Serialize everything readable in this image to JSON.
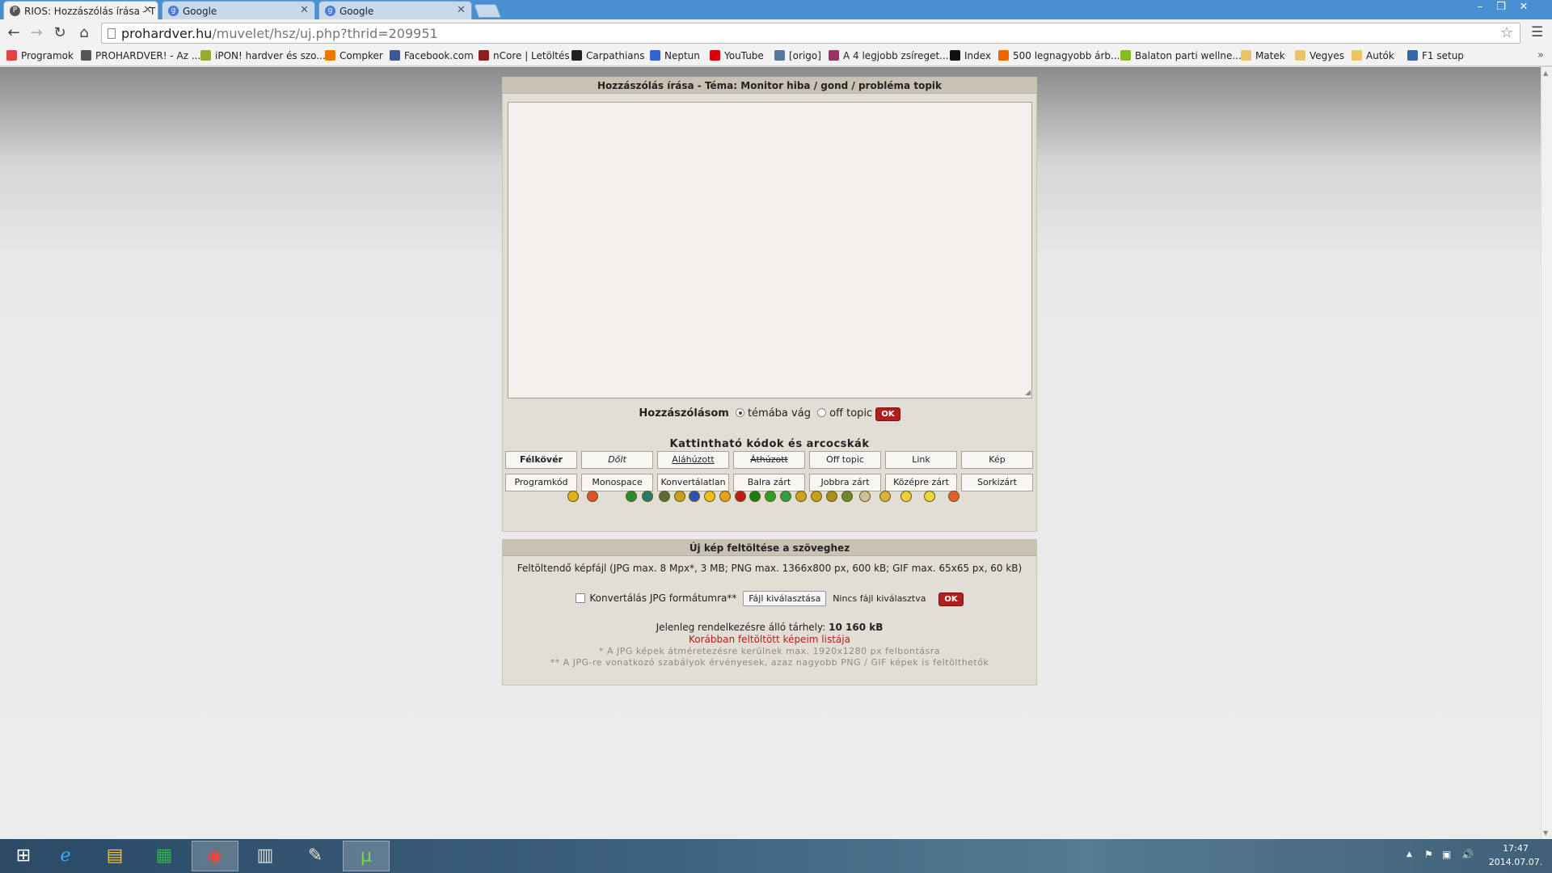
{
  "tabs": [
    {
      "title": "RIOS: Hozzászólás írása - T",
      "icon": "prohardver-icon",
      "active": true
    },
    {
      "title": "Google",
      "icon": "google-icon",
      "active": false
    },
    {
      "title": "Google",
      "icon": "google-icon",
      "active": false
    }
  ],
  "url": {
    "domain": "prohardver.hu",
    "path": "/muvelet/hsz/uj.php?thrid=209951"
  },
  "bookmarks": [
    {
      "label": "Programok",
      "icon": "apps-grid-icon",
      "color": "#d44"
    },
    {
      "label": "PROHARDVER! - Az ...",
      "icon": "prohardver-icon",
      "color": "#555"
    },
    {
      "label": "iPON! hardver és szo...",
      "icon": "ipon-icon",
      "color": "#9a3"
    },
    {
      "label": "Compker",
      "icon": "compker-icon",
      "color": "#e70"
    },
    {
      "label": "Facebook.com",
      "icon": "facebook-icon",
      "color": "#3b5998"
    },
    {
      "label": "nCore | Letöltés",
      "icon": "ncore-icon",
      "color": "#822"
    },
    {
      "label": "Carpathians",
      "icon": "carpathians-icon",
      "color": "#222"
    },
    {
      "label": "Neptun",
      "icon": "neptun-icon",
      "color": "#36c"
    },
    {
      "label": "YouTube",
      "icon": "youtube-icon",
      "color": "#d00"
    },
    {
      "label": "[origo]",
      "icon": "origo-icon",
      "color": "#579"
    },
    {
      "label": "A 4 legjobb zsíreget...",
      "icon": "bookmark-icon",
      "color": "#936"
    },
    {
      "label": "Index",
      "icon": "index-icon",
      "color": "#111"
    },
    {
      "label": "500 legnagyobb árb...",
      "icon": "bookmark-icon",
      "color": "#e60"
    },
    {
      "label": "Balaton parti wellne...",
      "icon": "bookmark-icon",
      "color": "#8b2"
    },
    {
      "label": "Matek",
      "icon": "folder-icon",
      "color": "#e9c46a"
    },
    {
      "label": "Vegyes",
      "icon": "folder-icon",
      "color": "#e9c46a"
    },
    {
      "label": "Autók",
      "icon": "folder-icon",
      "color": "#e9c46a"
    },
    {
      "label": "F1 setup",
      "icon": "bookmark-icon",
      "color": "#36a"
    }
  ],
  "post": {
    "header": "Hozzászólás írása - Téma: Monitor hiba / gond / probléma topik",
    "type_label": "Hozzászólásom",
    "opt_on_topic": "témába vág",
    "opt_off_topic": "off topic",
    "ok": "OK",
    "codes_title": "Kattintható kódok és arcocskák",
    "buttons_row1": [
      "Félkövér",
      "Dőlt",
      "Aláhúzott",
      "Áthúzott",
      "Off topic",
      "Link",
      "Kép"
    ],
    "buttons_row2": [
      "Programkód",
      "Monospace",
      "Konvertálatlan",
      "Balra zárt",
      "Jobbra zárt",
      "Középre zárt",
      "Sorkizárt"
    ]
  },
  "upload": {
    "header": "Új kép feltöltése a szöveghez",
    "info": "Feltöltendő képfájl (JPG max. 8 Mpx*, 3 MB; PNG max. 1366x800 px, 600 kB; GIF max. 65x65 px, 60 kB)",
    "convert_label": "Konvertálás JPG formátumra**",
    "file_button": "Fájl kiválasztása",
    "no_file": "Nincs fájl kiválasztva",
    "ok": "OK",
    "space_label": "Jelenleg rendelkezésre álló tárhely:",
    "space_value": "10 160 kB",
    "prev_link": "Korábban feltöltött képeim listája",
    "note1": "* A JPG képek átméretezésre kerülnek max. 1920x1280 px felbontásra",
    "note2": "** A JPG-re vonatkozó szabályok érvényesek, azaz nagyobb PNG / GIF képek is feltölthetők"
  },
  "taskbar": {
    "apps": [
      "start-icon",
      "internet-explorer-icon",
      "file-explorer-icon",
      "store-icon",
      "chrome-icon",
      "calculator-icon",
      "paint-icon",
      "utorrent-icon"
    ],
    "time": "17:47",
    "date": "2014.07.07."
  }
}
